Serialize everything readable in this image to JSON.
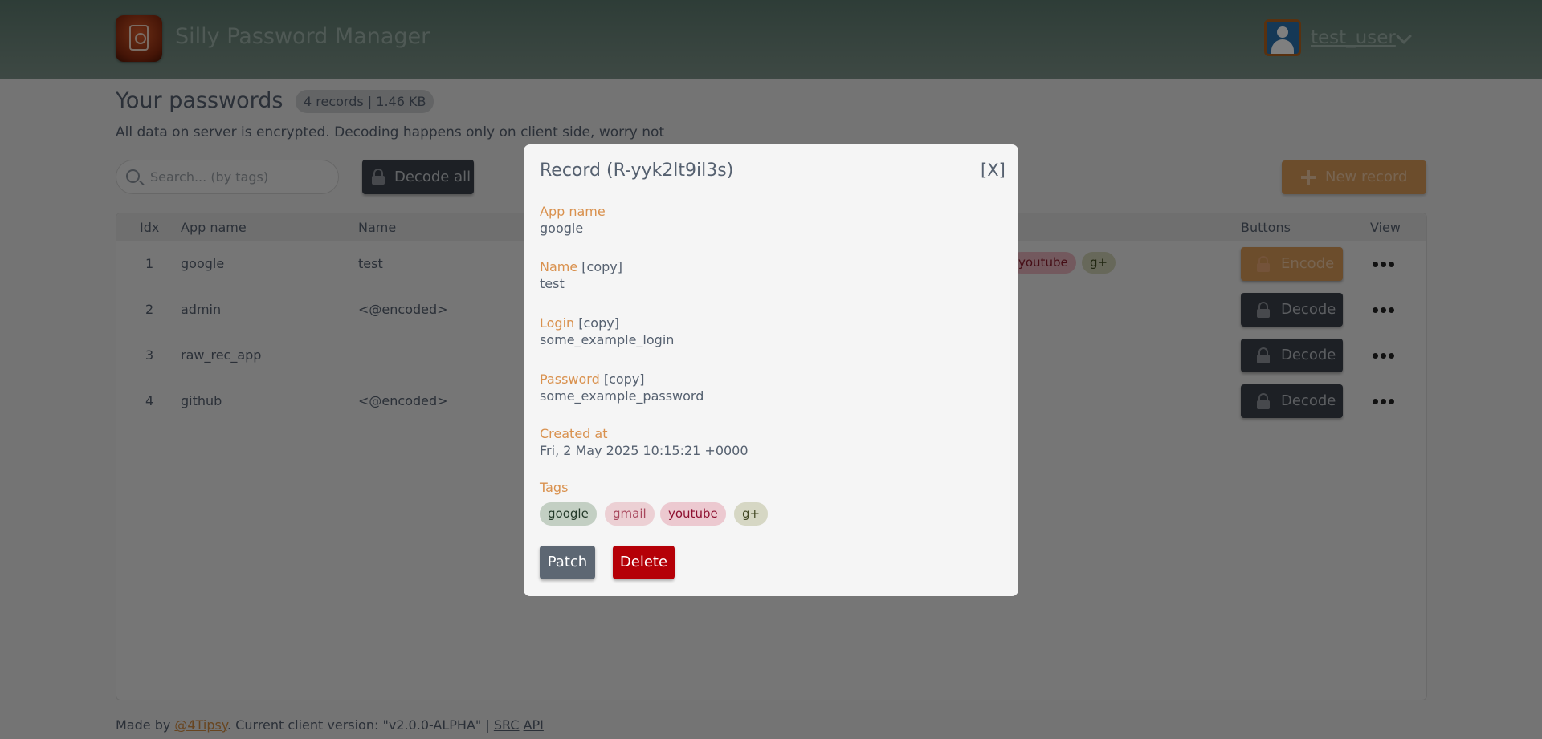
{
  "header": {
    "app_title": "Silly Password Manager",
    "username": "test_user",
    "icons": {
      "logo": "password-safe-logo",
      "avatar": "user-avatar-icon",
      "menu": "chevron-down-icon"
    }
  },
  "page": {
    "title": "Your passwords",
    "stats": "4 records | 1.46 KB",
    "subtitle": "All data on server is encrypted. Decoding happens only on client side, worry not"
  },
  "toolbar": {
    "search_placeholder": "Search... (by tags)",
    "decode_all_label": "Decode all",
    "new_record_label": "New record"
  },
  "table": {
    "columns": {
      "idx": "Idx",
      "app_name": "App name",
      "name": "Name",
      "buttons": "Buttons",
      "view": "View"
    },
    "rows": [
      {
        "idx": "1",
        "app_name": "google",
        "name": "test",
        "button": "Encode",
        "tags_visible": [
          "youtube",
          "g+"
        ]
      },
      {
        "idx": "2",
        "app_name": "admin",
        "name": "<@encoded>",
        "button": "Decode"
      },
      {
        "idx": "3",
        "app_name": "raw_rec_app",
        "name": "",
        "button": "Decode"
      },
      {
        "idx": "4",
        "app_name": "github",
        "name": "<@encoded>",
        "button": "Decode"
      }
    ]
  },
  "footer": {
    "made_by": "Made by ",
    "author": "@4Tipsy",
    "version_text": ". Current client version: \"v2.0.0-ALPHA\" | ",
    "src_link": "SRC",
    "api_link": "API"
  },
  "modal": {
    "title": "Record (R-yyk2lt9il3s)",
    "close": "[X]",
    "copy_label": "[copy]",
    "fields": {
      "app_name": {
        "label": "App name",
        "value": "google"
      },
      "name": {
        "label": "Name",
        "value": "test"
      },
      "login": {
        "label": "Login",
        "value": "some_example_login"
      },
      "password": {
        "label": "Password",
        "value": "some_example_password"
      },
      "created_at": {
        "label": "Created at",
        "value": "Fri, 2 May 2025 10:15:21 +0000"
      }
    },
    "tags_label": "Tags",
    "tags": [
      "google",
      "gmail",
      "youtube",
      "g+"
    ],
    "patch_label": "Patch",
    "delete_label": "Delete"
  },
  "colors": {
    "accent_orange": "#d99a59",
    "header_green": "#7c9288",
    "danger": "#b50007",
    "dark_button": "#3a414b"
  }
}
